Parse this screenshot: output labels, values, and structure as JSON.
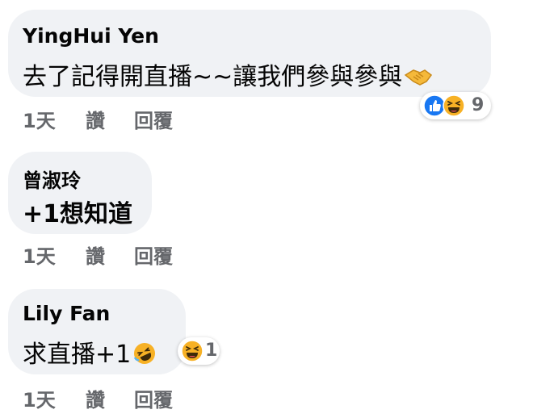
{
  "comments": [
    {
      "author": "YingHui Yen",
      "text": "去了記得開直播~~讓我們參與參與",
      "emoji": "handshake-emoji",
      "actions": {
        "time": "1天",
        "like": "讚",
        "reply": "回覆"
      },
      "reactions": {
        "icons": [
          "like-icon",
          "haha-icon"
        ],
        "count": "9",
        "colors": {
          "like": "#1877f2",
          "haha": "#f7b125"
        }
      }
    },
    {
      "author": "曾淑玲",
      "text": "+1想知道",
      "actions": {
        "time": "1天",
        "like": "讚",
        "reply": "回覆"
      }
    },
    {
      "author": "Lily Fan",
      "text": "求直播+1",
      "emoji": "rofl-emoji",
      "actions": {
        "time": "1天",
        "like": "讚",
        "reply": "回覆"
      },
      "reactions": {
        "icons": [
          "haha-icon"
        ],
        "count": "1"
      }
    }
  ]
}
